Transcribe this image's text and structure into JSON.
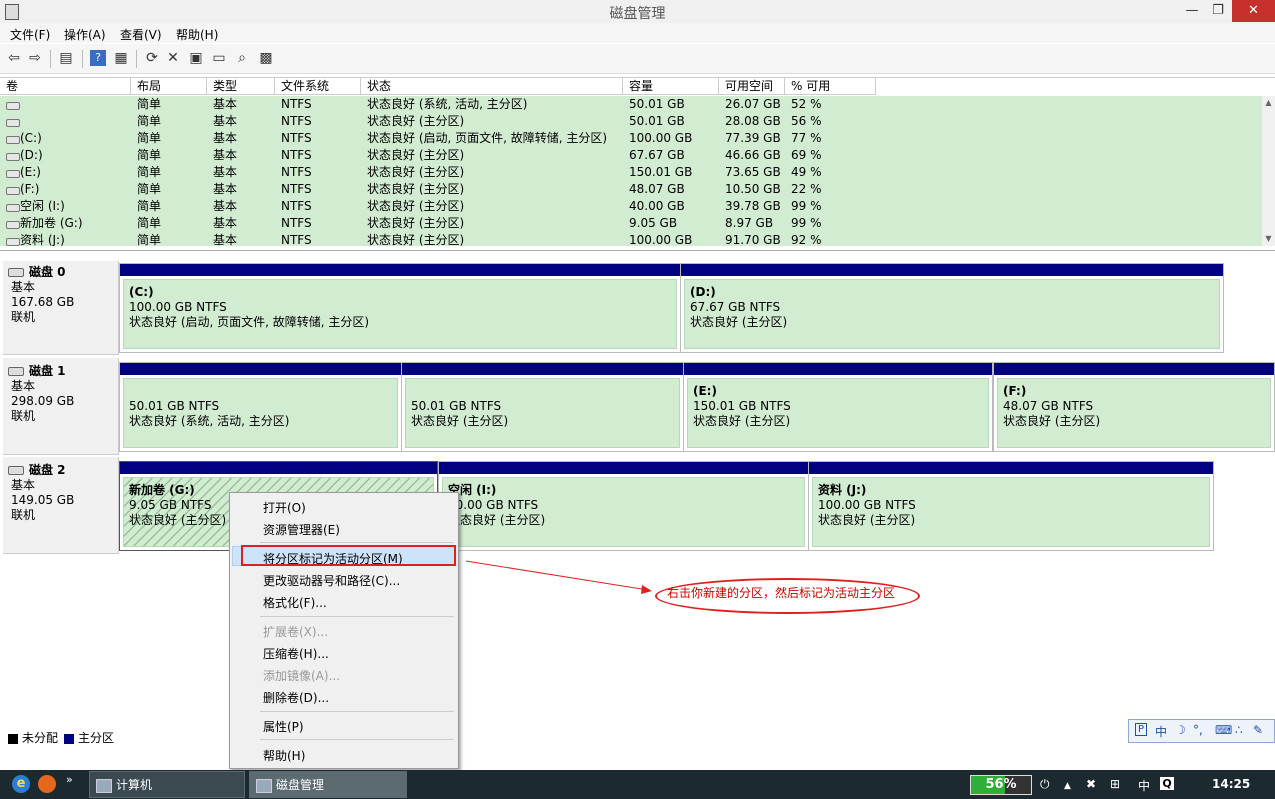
{
  "window": {
    "title": "磁盘管理"
  },
  "menu": [
    "文件(F)",
    "操作(A)",
    "查看(V)",
    "帮助(H)"
  ],
  "toolbar": [
    "back-icon",
    "forward-icon",
    "list-icon",
    "help-icon",
    "panel-icon",
    "refresh-icon",
    "delete-icon",
    "properties-icon",
    "open-icon",
    "find-icon",
    "export-icon"
  ],
  "columns": [
    "卷",
    "布局",
    "类型",
    "文件系统",
    "状态",
    "容量",
    "可用空间",
    "% 可用"
  ],
  "volumes": [
    {
      "name": "",
      "layout": "简单",
      "type": "基本",
      "fs": "NTFS",
      "status": "状态良好 (系统, 活动, 主分区)",
      "capacity": "50.01 GB",
      "free": "26.07 GB",
      "pct": "52 %"
    },
    {
      "name": "",
      "layout": "简单",
      "type": "基本",
      "fs": "NTFS",
      "status": "状态良好 (主分区)",
      "capacity": "50.01 GB",
      "free": "28.08 GB",
      "pct": "56 %"
    },
    {
      "name": "(C:)",
      "layout": "简单",
      "type": "基本",
      "fs": "NTFS",
      "status": "状态良好 (启动, 页面文件, 故障转储, 主分区)",
      "capacity": "100.00 GB",
      "free": "77.39 GB",
      "pct": "77 %"
    },
    {
      "name": "(D:)",
      "layout": "简单",
      "type": "基本",
      "fs": "NTFS",
      "status": "状态良好 (主分区)",
      "capacity": "67.67 GB",
      "free": "46.66 GB",
      "pct": "69 %"
    },
    {
      "name": "(E:)",
      "layout": "简单",
      "type": "基本",
      "fs": "NTFS",
      "status": "状态良好 (主分区)",
      "capacity": "150.01 GB",
      "free": "73.65 GB",
      "pct": "49 %"
    },
    {
      "name": "(F:)",
      "layout": "简单",
      "type": "基本",
      "fs": "NTFS",
      "status": "状态良好 (主分区)",
      "capacity": "48.07 GB",
      "free": "10.50 GB",
      "pct": "22 %"
    },
    {
      "name": "空闲 (I:)",
      "layout": "简单",
      "type": "基本",
      "fs": "NTFS",
      "status": "状态良好 (主分区)",
      "capacity": "40.00 GB",
      "free": "39.78 GB",
      "pct": "99 %"
    },
    {
      "name": "新加卷 (G:)",
      "layout": "简单",
      "type": "基本",
      "fs": "NTFS",
      "status": "状态良好 (主分区)",
      "capacity": "9.05 GB",
      "free": "8.97 GB",
      "pct": "99 %"
    },
    {
      "name": "资料 (J:)",
      "layout": "简单",
      "type": "基本",
      "fs": "NTFS",
      "status": "状态良好 (主分区)",
      "capacity": "100.00 GB",
      "free": "91.70 GB",
      "pct": "92 %"
    }
  ],
  "disks": [
    {
      "name": "磁盘 0",
      "kind": "基本",
      "size": "167.68 GB",
      "state": "联机",
      "partitions": [
        {
          "label": "(C:)",
          "size": "100.00 GB NTFS",
          "status": "状态良好 (启动, 页面文件, 故障转储, 主分区)"
        },
        {
          "label": "(D:)",
          "size": "67.67 GB NTFS",
          "status": "状态良好 (主分区)"
        }
      ]
    },
    {
      "name": "磁盘 1",
      "kind": "基本",
      "size": "298.09 GB",
      "state": "联机",
      "partitions": [
        {
          "label": "",
          "size": "50.01 GB NTFS",
          "status": "状态良好 (系统, 活动, 主分区)"
        },
        {
          "label": "",
          "size": "50.01 GB NTFS",
          "status": "状态良好 (主分区)"
        },
        {
          "label": "(E:)",
          "size": "150.01 GB NTFS",
          "status": "状态良好 (主分区)"
        },
        {
          "label": "(F:)",
          "size": "48.07 GB NTFS",
          "status": "状态良好 (主分区)"
        }
      ]
    },
    {
      "name": "磁盘 2",
      "kind": "基本",
      "size": "149.05 GB",
      "state": "联机",
      "partitions": [
        {
          "label": "新加卷 (G:)",
          "size": "9.05 GB NTFS",
          "status": "状态良好 (主分区)"
        },
        {
          "label": "空闲 (I:)",
          "size": "40.00 GB NTFS",
          "status": "状态良好 (主分区)"
        },
        {
          "label": "资料 (J:)",
          "size": "100.00 GB NTFS",
          "status": "状态良好 (主分区)"
        }
      ]
    }
  ],
  "legend": [
    {
      "label": "未分配",
      "color": "#000000"
    },
    {
      "label": "主分区",
      "color": "#000080"
    }
  ],
  "context_menu": {
    "items": [
      "打开(O)",
      "资源管理器(E)",
      "将分区标记为活动分区(M)",
      "更改驱动器号和路径(C)...",
      "格式化(F)...",
      "扩展卷(X)...",
      "压缩卷(H)...",
      "添加镜像(A)...",
      "删除卷(D)...",
      "属性(P)",
      "帮助(H)"
    ],
    "highlighted": "将分区标记为活动分区(M)",
    "disabled": [
      "扩展卷(X)...",
      "添加镜像(A)..."
    ]
  },
  "annotation": {
    "text": "右击你新建的分区，然后标记为活动主分区",
    "color": "#cc0000"
  },
  "ime": {
    "label": "中"
  },
  "taskbar": {
    "tasks": [
      "计算机",
      "磁盘管理"
    ],
    "battery_pct": "56%",
    "battery_level": 0.56,
    "lang": "中",
    "clock": "14:25"
  }
}
